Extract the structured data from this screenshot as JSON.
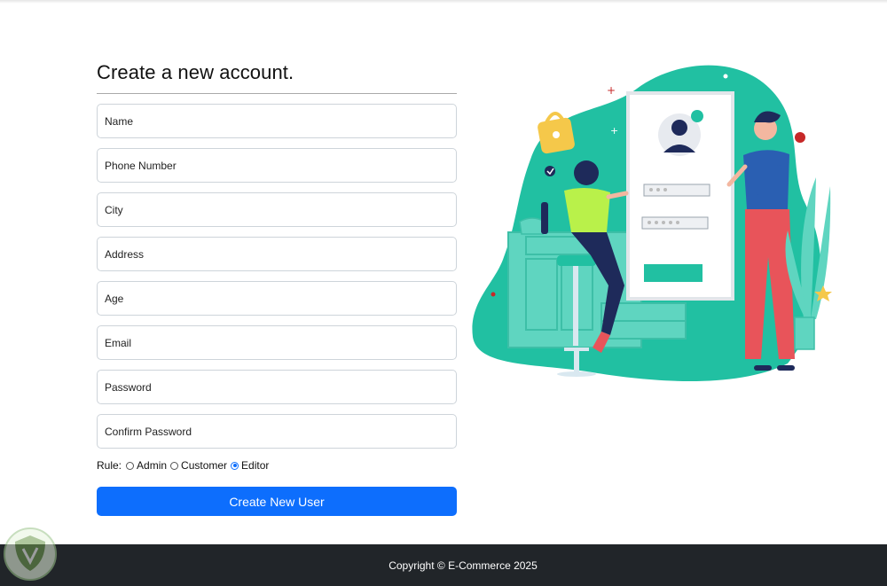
{
  "form": {
    "title": "Create a new account.",
    "fields": [
      {
        "name": "name-input",
        "placeholder": "Name"
      },
      {
        "name": "phone-number-input",
        "placeholder": "Phone Number"
      },
      {
        "name": "city-input",
        "placeholder": "City"
      },
      {
        "name": "address-input",
        "placeholder": "Address"
      },
      {
        "name": "age-input",
        "placeholder": "Age"
      },
      {
        "name": "email-input",
        "placeholder": "Email"
      },
      {
        "name": "password-input",
        "placeholder": "Password"
      },
      {
        "name": "confirm-password-input",
        "placeholder": "Confirm Password"
      }
    ],
    "rule_label": "Rule:",
    "rule_options": [
      {
        "label": "Admin",
        "checked": false
      },
      {
        "label": "Customer",
        "checked": false
      },
      {
        "label": "Editor",
        "checked": true
      }
    ],
    "submit_label": "Create New User"
  },
  "illustration": {
    "name": "account-signup-illustration"
  },
  "footer": {
    "copyright": "Copyright © E-Commerce 2025"
  },
  "colors": {
    "primary": "#0d6efd",
    "footer_bg": "#212529",
    "teal": "#21c0a2",
    "red_pants": "#e8545a",
    "blue_shirt": "#2a5fb2",
    "lime_shirt": "#b9f14a"
  }
}
